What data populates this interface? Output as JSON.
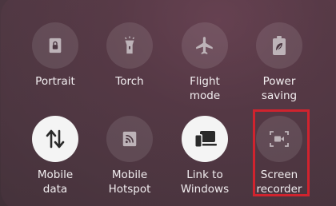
{
  "tiles": [
    {
      "label": "Portrait",
      "icon": "portrait-lock-icon",
      "active": false
    },
    {
      "label": "Torch",
      "icon": "flashlight-icon",
      "active": false
    },
    {
      "label": "Flight\nmode",
      "icon": "airplane-icon",
      "active": false
    },
    {
      "label": "Power\nsaving",
      "icon": "battery-leaf-icon",
      "active": false
    },
    {
      "label": "Mobile\ndata",
      "icon": "data-arrows-icon",
      "active": true
    },
    {
      "label": "Mobile\nHotspot",
      "icon": "hotspot-icon",
      "active": false
    },
    {
      "label": "Link to\nWindows",
      "icon": "link-to-windows-icon",
      "active": true
    },
    {
      "label": "Screen\nrecorder",
      "icon": "screen-recorder-icon",
      "active": false
    }
  ],
  "colors": {
    "highlight": "#d0232e",
    "icon_inactive": "#bdb3b8",
    "icon_active": "#2a2a2a"
  }
}
